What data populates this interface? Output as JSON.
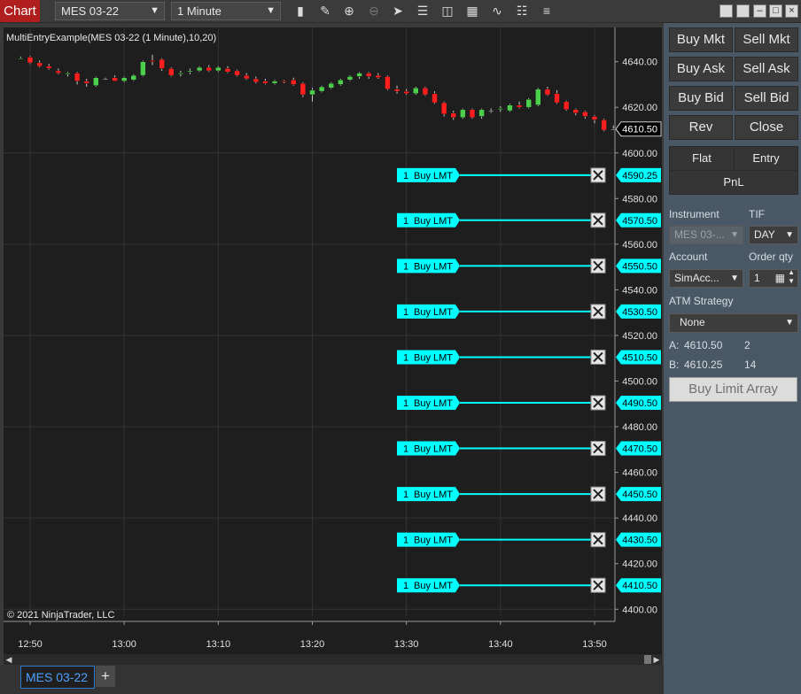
{
  "toolbar": {
    "chart_tab": "Chart",
    "instrument": "MES 03-22",
    "interval": "1 Minute",
    "icons": [
      "bars-icon",
      "pencil-icon",
      "zoom-in-icon",
      "zoom-out-icon",
      "cursor-icon",
      "properties-icon",
      "templates-icon",
      "data-box-icon",
      "indicators-icon",
      "strategies-icon",
      "menu-icon"
    ],
    "window_buttons": [
      "minimize",
      "maximize",
      "restore",
      "close"
    ]
  },
  "chart": {
    "title": "MultiEntryExample(MES 03-22 (1 Minute),10,20)",
    "copyright": "© 2021 NinjaTrader, LLC",
    "current_price": "4610.50",
    "colors": {
      "up": "#4cd04c",
      "down": "#ff1f1f",
      "order": "#00ffff",
      "last_price_bg": "#000000"
    }
  },
  "chart_data": {
    "type": "candlestick",
    "x_ticks": [
      "12:50",
      "13:00",
      "13:10",
      "13:20",
      "13:30",
      "13:40",
      "13:50"
    ],
    "y_ticks": [
      "4640.00",
      "4620.00",
      "4600.00",
      "4580.00",
      "4560.00",
      "4540.00",
      "4520.00",
      "4500.00",
      "4480.00",
      "4460.00",
      "4440.00",
      "4420.00",
      "4400.00"
    ],
    "ylim": [
      4397,
      4655
    ],
    "candles": [
      {
        "t": "12:49",
        "o": 4641.25,
        "h": 4642.25,
        "l": 4641.0,
        "c": 4641.5
      },
      {
        "t": "12:50",
        "o": 4642.0,
        "h": 4642.5,
        "l": 4639.0,
        "c": 4639.5
      },
      {
        "t": "12:51",
        "o": 4639.5,
        "h": 4640.5,
        "l": 4637.5,
        "c": 4638.0
      },
      {
        "t": "12:52",
        "o": 4638.0,
        "h": 4639.0,
        "l": 4636.5,
        "c": 4637.0
      },
      {
        "t": "12:53",
        "o": 4636.0,
        "h": 4637.0,
        "l": 4634.5,
        "c": 4635.0
      },
      {
        "t": "12:54",
        "o": 4634.5,
        "h": 4635.5,
        "l": 4633.5,
        "c": 4635.0
      },
      {
        "t": "12:55",
        "o": 4635.0,
        "h": 4635.5,
        "l": 4630.0,
        "c": 4631.5
      },
      {
        "t": "12:56",
        "o": 4631.5,
        "h": 4632.5,
        "l": 4629.0,
        "c": 4630.5
      },
      {
        "t": "12:57",
        "o": 4629.5,
        "h": 4633.5,
        "l": 4629.0,
        "c": 4633.0
      },
      {
        "t": "12:58",
        "o": 4632.5,
        "h": 4633.0,
        "l": 4632.0,
        "c": 4632.5
      },
      {
        "t": "12:59",
        "o": 4633.0,
        "h": 4634.0,
        "l": 4631.5,
        "c": 4631.5
      },
      {
        "t": "13:00",
        "o": 4631.5,
        "h": 4633.5,
        "l": 4631.0,
        "c": 4633.0
      },
      {
        "t": "13:01",
        "o": 4632.0,
        "h": 4634.5,
        "l": 4631.5,
        "c": 4634.0
      },
      {
        "t": "13:02",
        "o": 4634.0,
        "h": 4640.5,
        "l": 4633.5,
        "c": 4640.0
      },
      {
        "t": "13:03",
        "o": 4640.5,
        "h": 4643.0,
        "l": 4638.5,
        "c": 4640.0
      },
      {
        "t": "13:04",
        "o": 4641.0,
        "h": 4641.5,
        "l": 4636.0,
        "c": 4637.0
      },
      {
        "t": "13:05",
        "o": 4637.0,
        "h": 4637.5,
        "l": 4633.5,
        "c": 4634.0
      },
      {
        "t": "13:06",
        "o": 4634.5,
        "h": 4636.0,
        "l": 4633.5,
        "c": 4635.0
      },
      {
        "t": "13:07",
        "o": 4635.5,
        "h": 4637.0,
        "l": 4634.5,
        "c": 4636.0
      },
      {
        "t": "13:08",
        "o": 4636.0,
        "h": 4638.0,
        "l": 4635.5,
        "c": 4637.5
      },
      {
        "t": "13:09",
        "o": 4637.5,
        "h": 4638.5,
        "l": 4635.5,
        "c": 4636.0
      },
      {
        "t": "13:10",
        "o": 4636.0,
        "h": 4638.0,
        "l": 4635.5,
        "c": 4637.5
      },
      {
        "t": "13:11",
        "o": 4637.0,
        "h": 4638.0,
        "l": 4635.0,
        "c": 4635.5
      },
      {
        "t": "13:12",
        "o": 4636.0,
        "h": 4636.5,
        "l": 4633.5,
        "c": 4634.0
      },
      {
        "t": "13:13",
        "o": 4634.0,
        "h": 4635.0,
        "l": 4632.0,
        "c": 4632.5
      },
      {
        "t": "13:14",
        "o": 4632.5,
        "h": 4633.5,
        "l": 4630.5,
        "c": 4631.0
      },
      {
        "t": "13:15",
        "o": 4631.5,
        "h": 4632.5,
        "l": 4630.0,
        "c": 4630.5
      },
      {
        "t": "13:16",
        "o": 4630.5,
        "h": 4632.0,
        "l": 4630.0,
        "c": 4631.5
      },
      {
        "t": "13:17",
        "o": 4631.5,
        "h": 4632.0,
        "l": 4630.5,
        "c": 4631.0
      },
      {
        "t": "13:18",
        "o": 4632.0,
        "h": 4633.0,
        "l": 4629.5,
        "c": 4630.0
      },
      {
        "t": "13:19",
        "o": 4630.5,
        "h": 4631.0,
        "l": 4624.5,
        "c": 4625.5
      },
      {
        "t": "13:20",
        "o": 4625.5,
        "h": 4628.5,
        "l": 4622.5,
        "c": 4627.5
      },
      {
        "t": "13:21",
        "o": 4627.0,
        "h": 4629.5,
        "l": 4626.5,
        "c": 4629.0
      },
      {
        "t": "13:22",
        "o": 4628.5,
        "h": 4631.0,
        "l": 4628.0,
        "c": 4630.5
      },
      {
        "t": "13:23",
        "o": 4630.0,
        "h": 4632.5,
        "l": 4629.5,
        "c": 4632.0
      },
      {
        "t": "13:24",
        "o": 4632.0,
        "h": 4634.0,
        "l": 4631.5,
        "c": 4633.5
      },
      {
        "t": "13:25",
        "o": 4633.5,
        "h": 4635.5,
        "l": 4632.5,
        "c": 4635.0
      },
      {
        "t": "13:26",
        "o": 4635.0,
        "h": 4635.5,
        "l": 4632.5,
        "c": 4633.5
      },
      {
        "t": "13:27",
        "o": 4634.0,
        "h": 4635.0,
        "l": 4632.5,
        "c": 4633.0
      },
      {
        "t": "13:28",
        "o": 4633.5,
        "h": 4634.0,
        "l": 4627.5,
        "c": 4628.0
      },
      {
        "t": "13:29",
        "o": 4628.0,
        "h": 4629.5,
        "l": 4626.0,
        "c": 4627.0
      },
      {
        "t": "13:30",
        "o": 4627.0,
        "h": 4628.0,
        "l": 4625.5,
        "c": 4626.0
      },
      {
        "t": "13:31",
        "o": 4626.0,
        "h": 4629.0,
        "l": 4625.5,
        "c": 4628.5
      },
      {
        "t": "13:32",
        "o": 4628.5,
        "h": 4629.0,
        "l": 4625.0,
        "c": 4625.5
      },
      {
        "t": "13:33",
        "o": 4626.0,
        "h": 4627.0,
        "l": 4621.5,
        "c": 4622.0
      },
      {
        "t": "13:34",
        "o": 4622.0,
        "h": 4622.5,
        "l": 4616.0,
        "c": 4617.0
      },
      {
        "t": "13:35",
        "o": 4617.5,
        "h": 4618.5,
        "l": 4614.5,
        "c": 4615.5
      },
      {
        "t": "13:36",
        "o": 4615.5,
        "h": 4619.5,
        "l": 4615.0,
        "c": 4619.0
      },
      {
        "t": "13:37",
        "o": 4619.0,
        "h": 4619.5,
        "l": 4615.0,
        "c": 4615.5
      },
      {
        "t": "13:38",
        "o": 4616.0,
        "h": 4619.5,
        "l": 4615.0,
        "c": 4619.0
      },
      {
        "t": "13:39",
        "o": 4618.5,
        "h": 4619.5,
        "l": 4617.5,
        "c": 4618.5
      },
      {
        "t": "13:40",
        "o": 4619.0,
        "h": 4620.5,
        "l": 4618.0,
        "c": 4619.5
      },
      {
        "t": "13:41",
        "o": 4618.5,
        "h": 4621.5,
        "l": 4618.0,
        "c": 4621.0
      },
      {
        "t": "13:42",
        "o": 4621.0,
        "h": 4622.5,
        "l": 4619.5,
        "c": 4620.0
      },
      {
        "t": "13:43",
        "o": 4620.0,
        "h": 4624.0,
        "l": 4619.5,
        "c": 4623.5
      },
      {
        "t": "13:44",
        "o": 4621.0,
        "h": 4628.5,
        "l": 4620.5,
        "c": 4628.0
      },
      {
        "t": "13:45",
        "o": 4628.0,
        "h": 4629.0,
        "l": 4625.0,
        "c": 4625.5
      },
      {
        "t": "13:46",
        "o": 4626.0,
        "h": 4627.5,
        "l": 4621.5,
        "c": 4622.0
      },
      {
        "t": "13:47",
        "o": 4622.5,
        "h": 4623.0,
        "l": 4618.5,
        "c": 4619.0
      },
      {
        "t": "13:48",
        "o": 4619.0,
        "h": 4619.5,
        "l": 4616.5,
        "c": 4617.5
      },
      {
        "t": "13:49",
        "o": 4618.0,
        "h": 4618.5,
        "l": 4615.0,
        "c": 4616.0
      },
      {
        "t": "13:50",
        "o": 4616.0,
        "h": 4616.5,
        "l": 4613.0,
        "c": 4614.5
      },
      {
        "t": "13:51",
        "o": 4614.5,
        "h": 4615.0,
        "l": 4609.5,
        "c": 4610.0
      },
      {
        "t": "13:52",
        "o": 4610.5,
        "h": 4612.0,
        "l": 4610.0,
        "c": 4610.5
      }
    ],
    "orders": [
      {
        "qty": "1",
        "label": "Buy LMT",
        "price": "4590.25"
      },
      {
        "qty": "1",
        "label": "Buy LMT",
        "price": "4570.50"
      },
      {
        "qty": "1",
        "label": "Buy LMT",
        "price": "4550.50"
      },
      {
        "qty": "1",
        "label": "Buy LMT",
        "price": "4530.50"
      },
      {
        "qty": "1",
        "label": "Buy LMT",
        "price": "4510.50"
      },
      {
        "qty": "1",
        "label": "Buy LMT",
        "price": "4490.50"
      },
      {
        "qty": "1",
        "label": "Buy LMT",
        "price": "4470.50"
      },
      {
        "qty": "1",
        "label": "Buy LMT",
        "price": "4450.50"
      },
      {
        "qty": "1",
        "label": "Buy LMT",
        "price": "4430.50"
      },
      {
        "qty": "1",
        "label": "Buy LMT",
        "price": "4410.50"
      }
    ]
  },
  "panel": {
    "buy_mkt": "Buy Mkt",
    "sell_mkt": "Sell Mkt",
    "buy_ask": "Buy Ask",
    "sell_ask": "Sell Ask",
    "buy_bid": "Buy Bid",
    "sell_bid": "Sell Bid",
    "rev": "Rev",
    "close": "Close",
    "flat": "Flat",
    "entry": "Entry",
    "pnl": "PnL",
    "instrument_label": "Instrument",
    "instrument_value": "MES 03-...",
    "tif_label": "TIF",
    "tif_value": "DAY",
    "account_label": "Account",
    "account_value": "SimAcc...",
    "order_qty_label": "Order qty",
    "order_qty_value": "1",
    "atm_label": "ATM Strategy",
    "atm_value": "None",
    "ask_label": "A:",
    "ask_price": "4610.50",
    "ask_size": "2",
    "bid_label": "B:",
    "bid_price": "4610.25",
    "bid_size": "14",
    "buy_limit_array": "Buy Limit Array"
  },
  "bottom": {
    "tab": "MES 03-22",
    "add": "+"
  }
}
